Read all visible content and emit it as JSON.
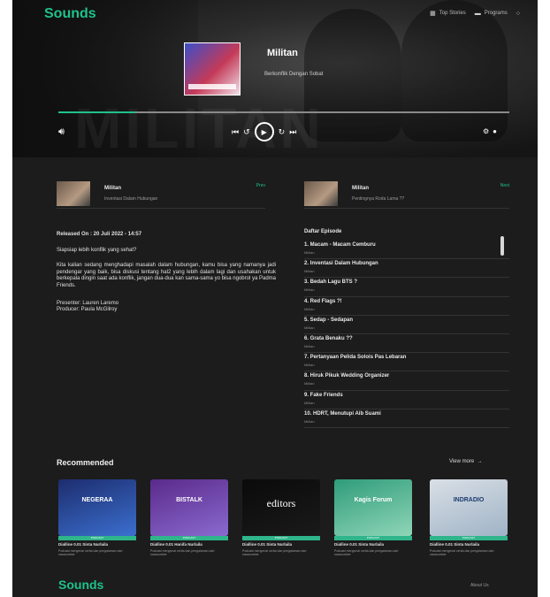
{
  "header": {
    "logo": "Sounds",
    "nav": [
      {
        "label": "Top Stories",
        "icon": "grid-icon"
      },
      {
        "label": "Programs",
        "icon": "folder-icon"
      },
      {
        "label": "",
        "icon": "search-icon"
      }
    ]
  },
  "player": {
    "title": "Militan",
    "subtitle": "Berkonflik Dengan Sobat",
    "watermark": "MILITAN",
    "progress": 0.17
  },
  "episode_cards": [
    {
      "title": "Militan",
      "subtitle": "Inventasi Dalam Hubungan",
      "tag": "Prev"
    },
    {
      "title": "Militan",
      "subtitle": "Pentingnya Roda Lama ??",
      "tag": "Next"
    }
  ],
  "description": {
    "released": "Released On : 20 Juli 2022 - 14:57",
    "question": "Siapsiap lebih konflik yang sehat?",
    "body": "Kita kalian sedang menghadapi masalah dalam hubungan, kamu bisa yang namanya jadi pendengar yang baik, bisa diskusi tentang hal2 yang lebih dalam lagi dan usahakan untuk berkepala dingin saat ada konflik, jangan dua-dua kan sama-sama yo bisa ngobrol ya Padma Friends.",
    "presenter": "Presenter: Lauren Laremo",
    "producer": "Producer: Paula McGilroy"
  },
  "episodes_section": {
    "heading": "Daftar Episode",
    "items": [
      {
        "title": "1. Macam - Macam Cemburu",
        "meta": "Militan"
      },
      {
        "title": "2. Inventasi Dalam Hubungan",
        "meta": "Militan"
      },
      {
        "title": "3. Bedah Lagu BTS ?",
        "meta": "Militan"
      },
      {
        "title": "4. Red Flags ?!",
        "meta": "Militan"
      },
      {
        "title": "5. Sedap - Sedapan",
        "meta": "Militan"
      },
      {
        "title": "6. Grata Benaku ??",
        "meta": "Militan"
      },
      {
        "title": "7. Pertanyaan Pelida Solois Pas Lebaran",
        "meta": "Militan"
      },
      {
        "title": "8. Hiruk Pikuk Wedding Organizer",
        "meta": "Militan"
      },
      {
        "title": "9. Fake Friends",
        "meta": "Militan"
      },
      {
        "title": "10. HDRT, Menutupi Aib Suami",
        "meta": "Militan"
      }
    ]
  },
  "recommended": {
    "title": "Recommended",
    "view_more": "View more",
    "items": [
      {
        "cover_text": "NEGERAA",
        "strip": "PODCAST",
        "name": "Dialline 0.01 Sinta Nurlaila",
        "desc": "Podcast mengenai cerita dan pengalaman dari narasumber",
        "colors": [
          "#1d2d6e",
          "#3b6fcf"
        ]
      },
      {
        "cover_text": "BISTALK",
        "strip": "PODCAST",
        "name": "Dialline 0.01 Hanifa Nurlaila",
        "desc": "Podcast mengenai cerita dan pengalaman dari narasumber",
        "colors": [
          "#5a2a8a",
          "#8a6ad0"
        ]
      },
      {
        "cover_text": "editors",
        "strip": "PODCAST",
        "name": "Dialline 0.01 Sinta Nurlaila",
        "desc": "Podcast mengenai cerita dan pengalaman dari narasumber",
        "colors": [
          "#0a0a0a",
          "#1a1a1a"
        ]
      },
      {
        "cover_text": "Kagis Forum",
        "strip": "PODCAST",
        "name": "Dialline 0.01 Sinta Nurlaila",
        "desc": "Podcast mengenai cerita dan pengalaman dari narasumber",
        "colors": [
          "#2f9c7a",
          "#8fd6b8"
        ]
      },
      {
        "cover_text": "INDRADIO",
        "strip": "PODCAST",
        "name": "Dialline 0.01 Sinta Nurlaila",
        "desc": "Podcast mengenai cerita dan pengalaman dari narasumber",
        "colors": [
          "#d9dfe6",
          "#9fb3c6"
        ]
      }
    ]
  },
  "footer": {
    "logo": "Sounds",
    "link": "About Us"
  },
  "colors": {
    "accent": "#1ec28b",
    "background": "#1c1c1c"
  }
}
